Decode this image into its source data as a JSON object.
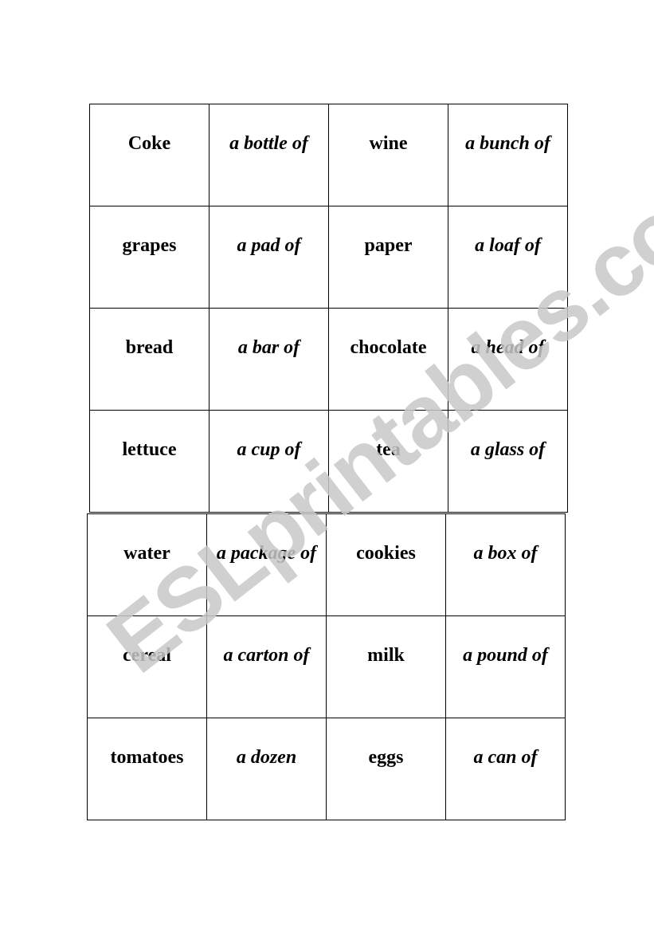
{
  "watermark": "ESLprintables.com",
  "table1": [
    [
      "Coke",
      "a bottle of",
      "wine",
      "a bunch of"
    ],
    [
      "grapes",
      "a pad of",
      "paper",
      "a loaf of"
    ],
    [
      "bread",
      "a bar of",
      "chocolate",
      "a head of"
    ],
    [
      "lettuce",
      "a cup of",
      "tea",
      "a glass of"
    ]
  ],
  "table2": [
    [
      "water",
      "a package of",
      "cookies",
      "a box of"
    ],
    [
      "cereal",
      "a carton of",
      "milk",
      "a pound of"
    ],
    [
      "tomatoes",
      "a dozen",
      "eggs",
      "a can of"
    ]
  ]
}
